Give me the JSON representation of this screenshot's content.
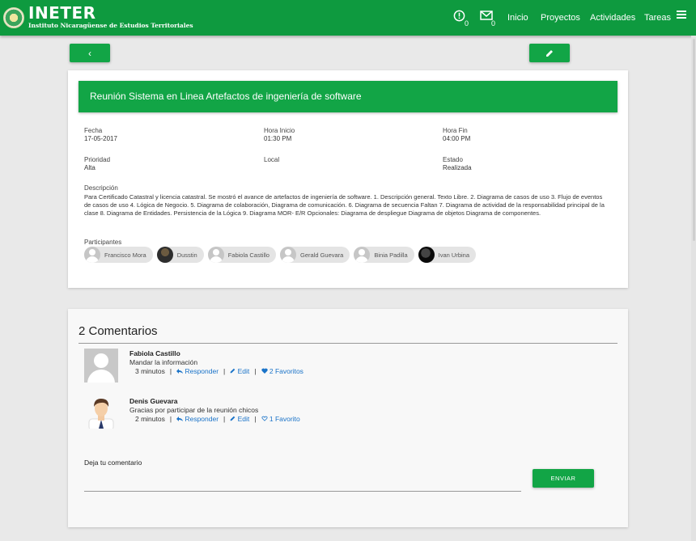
{
  "nav": {
    "brand": "INETER",
    "brand_sub": "Instituto Nicaragüense de Estudios Territoriales",
    "alerts_count": "0",
    "messages_count": "0",
    "links": [
      "Inicio",
      "Proyectos",
      "Actividades",
      "Tareas"
    ]
  },
  "actions": {
    "back_icon": "‹"
  },
  "meeting": {
    "title": "Reunión Sistema en Linea Artefactos de ingeniería de software",
    "fields": {
      "fecha_label": "Fecha",
      "fecha_value": "17-05-2017",
      "hora_inicio_label": "Hora Inicio",
      "hora_inicio_value": "01:30 PM",
      "hora_fin_label": "Hora Fin",
      "hora_fin_value": "04:00 PM",
      "prioridad_label": "Prioridad",
      "prioridad_value": "Alta",
      "local_label": "Local",
      "local_value": "",
      "estado_label": "Estado",
      "estado_value": "Realizada"
    },
    "description_label": "Descripción",
    "description": "Para Certificado Catastral y licencia catastral. Se mostró el avance de artefactos de ingeniería de software. 1. Descripción general. Texto Libre. 2. Diagrama de casos de uso 3. Flujo de eventos de casos de uso 4. Lógica de Negocio. 5. Diagrama de colaboración, Diagrama de comunicación. 6. Diagrama de secuencia Faltan 7. Diagrama de actividad de la responsabilidad principal de la clase 8. Diagrama de Entidades. Persistencia de la Lógica 9. Diagrama MOR- E/R Opcionales: Diagrama de despliegue Diagrama de objetos Diagrama de componentes.",
    "participants_label": "Participantes",
    "participants": [
      "Francisco Mora",
      "Dusstin",
      "Fabiola Castillo",
      "Gerald Guevara",
      "Binia Padilla",
      "Ivan Urbina"
    ]
  },
  "comments": {
    "title": "2 Comentarios",
    "items": [
      {
        "author": "Fabiola Castillo",
        "text": "Mandar la información",
        "time": "3 minutos",
        "reply": "Responder",
        "edit": "Edit",
        "favorites": "2 Favoritos"
      },
      {
        "author": "Denis Guevara",
        "text": "Gracias por participar de la reunión chicos",
        "time": "2 minutos",
        "reply": "Responder",
        "edit": "Edit",
        "favorites": "1 Favorito"
      }
    ],
    "separator": "|",
    "leave_label": "Deja tu comentario",
    "input_value": "",
    "input_placeholder": "",
    "send_label": "ENVIAR"
  },
  "colors": {
    "primary": "#12a546",
    "topbar": "#0e9a3f",
    "link": "#1a73c8"
  }
}
